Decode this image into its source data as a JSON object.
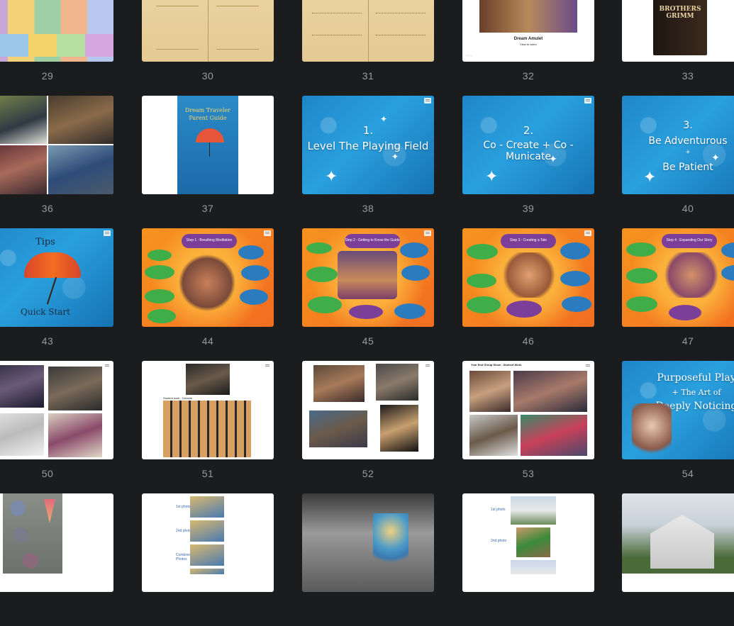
{
  "rows": [
    {
      "slides": [
        {
          "number": "29",
          "type": "color-grid"
        },
        {
          "number": "30",
          "type": "parchment-book"
        },
        {
          "number": "31",
          "type": "parchment-book"
        },
        {
          "number": "32",
          "type": "video",
          "title": "Dream Amulet",
          "subtitle": "View to video"
        },
        {
          "number": "33",
          "type": "book-cover",
          "cover_title": "BROTHERS GRIMM"
        }
      ]
    },
    {
      "slides": [
        {
          "number": "36",
          "type": "photo-collage"
        },
        {
          "number": "37",
          "type": "guide-cover",
          "title_line1": "Dream Traveler",
          "title_line2": "Parent Guide"
        },
        {
          "number": "38",
          "type": "blue-title",
          "title_line1": "1.",
          "title_line2": "Level The Playing Field"
        },
        {
          "number": "39",
          "type": "blue-title",
          "title_line1": "2.",
          "title_line2": "Co - Create + Co - Municate"
        },
        {
          "number": "40",
          "type": "blue-title3",
          "title_line1": "3.",
          "title_line2": "Be Adventurous",
          "title_line3": "+",
          "title_line4": "Be Patient"
        }
      ]
    },
    {
      "slides": [
        {
          "number": "43",
          "type": "tips",
          "title_top": "Tips",
          "title_bottom": "Quick Start"
        },
        {
          "number": "44",
          "type": "orange-step",
          "step_title": "Step 1 : Breathing Meditation"
        },
        {
          "number": "45",
          "type": "orange-step",
          "step_title": "Step 2 : Getting to Know the Guide"
        },
        {
          "number": "46",
          "type": "orange-step",
          "step_title": "Step 3 : Creating a Tale"
        },
        {
          "number": "47",
          "type": "orange-step",
          "step_title": "Step 4 : Expanding Our Story"
        }
      ]
    },
    {
      "slides": [
        {
          "number": "50",
          "type": "craft-collage"
        },
        {
          "number": "51",
          "type": "student-work",
          "caption": "Student work - Dreams"
        },
        {
          "number": "52",
          "type": "photo-captions"
        },
        {
          "number": "53",
          "type": "group-show",
          "caption": "Year End Group Show - Student Work"
        },
        {
          "number": "54",
          "type": "purposeful",
          "title_line1": "Purposeful Play",
          "title_line2": "+ The Art of",
          "title_line3": "Deeply Noticing"
        }
      ]
    },
    {
      "slides": [
        {
          "number": "",
          "type": "clay-craft"
        },
        {
          "number": "",
          "type": "photo-list",
          "labels": [
            "1st photo",
            "2nd photo",
            "Combined Photos"
          ]
        },
        {
          "number": "",
          "type": "bw-scene"
        },
        {
          "number": "",
          "type": "photo-list2",
          "labels": [
            "1st photo",
            "2nd photo"
          ]
        },
        {
          "number": "",
          "type": "house"
        }
      ]
    }
  ],
  "colors": {
    "background": "#1b1c1e",
    "slide_number": "#9a9b9e",
    "blue_slide": "#1e86c9",
    "orange_slide": "#f7931e"
  }
}
